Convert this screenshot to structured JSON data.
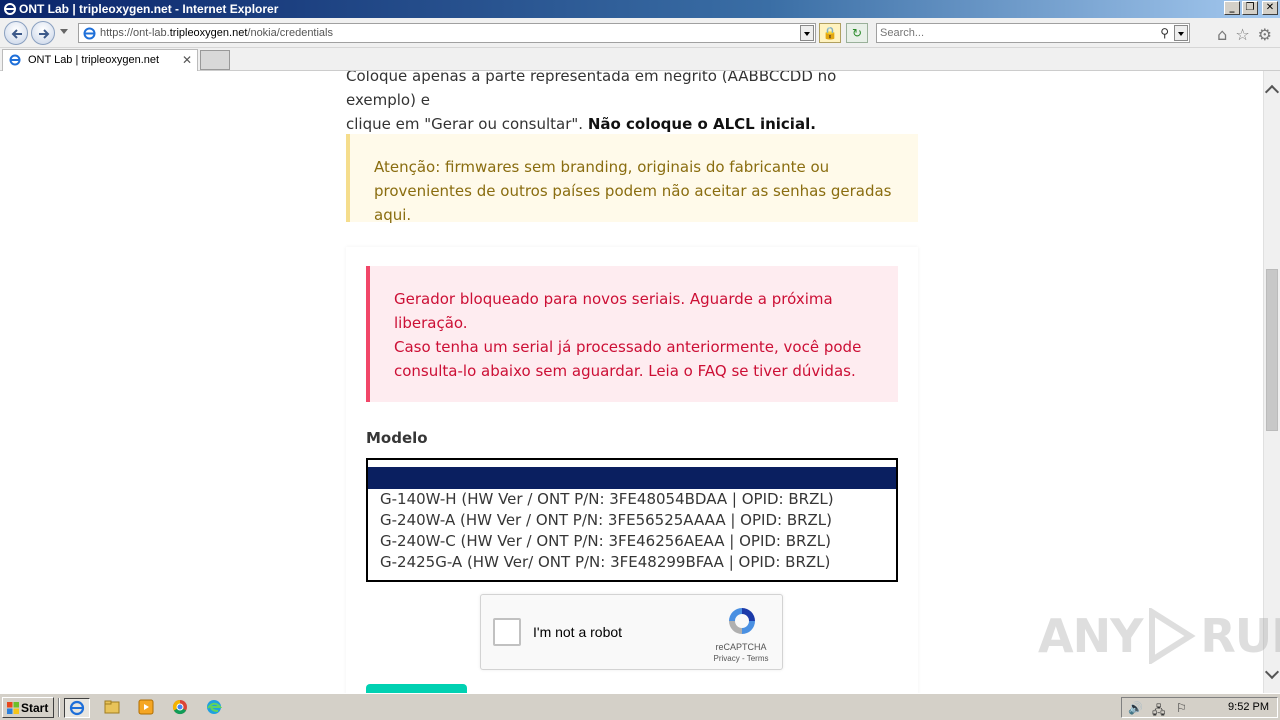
{
  "window": {
    "title": "ONT Lab | tripleoxygen.net - Internet Explorer",
    "minimize": "_",
    "restore": "❐",
    "close": "✕"
  },
  "nav": {
    "url_prefix": "https://ont-lab.",
    "url_domain": "tripleoxygen.net",
    "url_path": "/nokia/credentials",
    "search_placeholder": "Search..."
  },
  "tab": {
    "title": "ONT Lab | tripleoxygen.net",
    "close": "✕"
  },
  "page": {
    "intro_line1": "Coloque apenas a parte representada em negrito (AABBCCDD no exemplo) e",
    "intro_line2": "clique em \"Gerar ou consultar\". ",
    "intro_bold": "Não coloque o ALCL inicial.",
    "warning_line1": "Atenção: firmwares sem branding, originais do fabricante ou",
    "warning_line2": "provenientes de outros países podem não aceitar as senhas geradas aqui.",
    "danger_line1": "Gerador bloqueado para novos seriais. Aguarde a próxima",
    "danger_line2": "liberação.",
    "danger_line3": "Caso tenha um serial já processado anteriormente, você pode",
    "danger_line4": "consulta-lo abaixo sem aguardar. Leia o FAQ se tiver dúvidas.",
    "model_label": "Modelo",
    "model_options": [
      "G-140W-H (HW Ver / ONT P/N: 3FE48054BDAA | OPID: BRZL)",
      "G-240W-A (HW Ver / ONT P/N: 3FE56525AAAA | OPID: BRZL)",
      "G-240W-C (HW Ver / ONT P/N: 3FE46256AEAA | OPID: BRZL)",
      "G-2425G-A (HW Ver/ ONT P/N: 3FE48299BFAA | OPID: BRZL)"
    ],
    "recaptcha_label": "I'm not a robot",
    "recaptcha_brand": "reCAPTCHA",
    "recaptcha_links": "Privacy - Terms"
  },
  "watermark": {
    "left": "ANY",
    "right": "RUN"
  },
  "taskbar": {
    "start_label": "Start",
    "clock": "9:52 PM"
  },
  "colors": {
    "warning_bg": "#fffaea",
    "warning_text": "#8a6d10",
    "danger_bg": "#feecf0",
    "danger_text": "#cc0f35",
    "accent": "#00d1b2",
    "selection": "#0a1f60"
  }
}
